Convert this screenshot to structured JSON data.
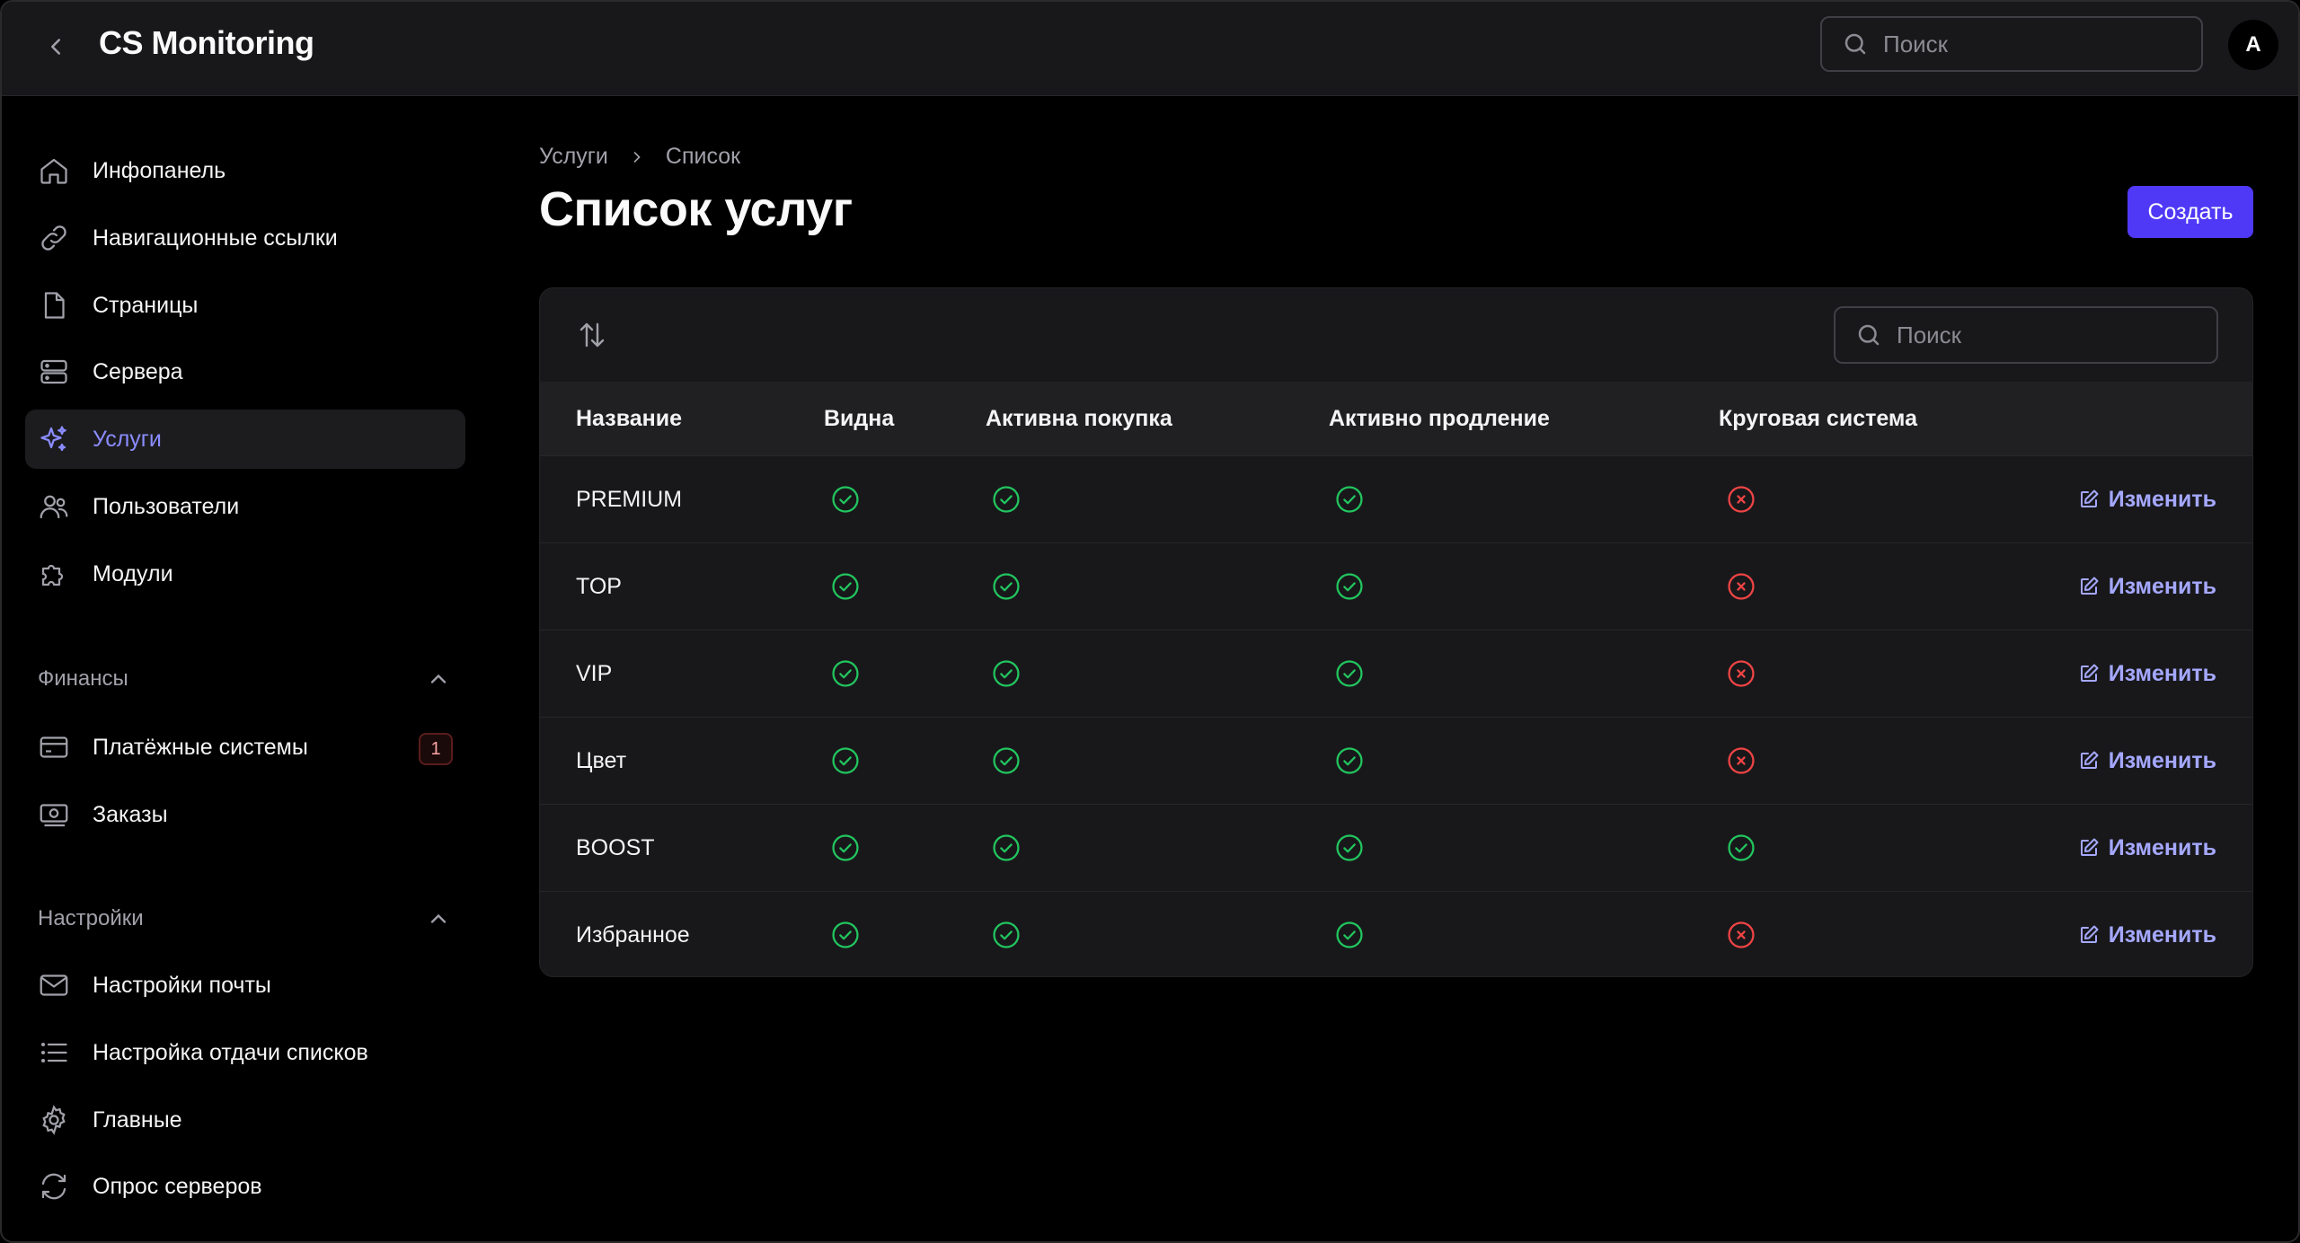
{
  "header": {
    "title": "CS Monitoring",
    "search_placeholder": "Поиск",
    "avatar_initial": "A"
  },
  "sidebar": {
    "items": [
      {
        "label": "Инфопанель",
        "icon": "home-icon"
      },
      {
        "label": "Навигационные ссылки",
        "icon": "link-icon"
      },
      {
        "label": "Страницы",
        "icon": "page-icon"
      },
      {
        "label": "Сервера",
        "icon": "server-icon"
      },
      {
        "label": "Услуги",
        "icon": "sparkles-icon",
        "active": true
      },
      {
        "label": "Пользователи",
        "icon": "users-icon"
      },
      {
        "label": "Модули",
        "icon": "puzzle-icon"
      }
    ],
    "finance": {
      "title": "Финансы",
      "items": [
        {
          "label": "Платёжные системы",
          "icon": "credit-card-icon",
          "badge": "1"
        },
        {
          "label": "Заказы",
          "icon": "banknote-icon"
        }
      ]
    },
    "settings": {
      "title": "Настройки",
      "items": [
        {
          "label": "Настройки почты",
          "icon": "mail-icon"
        },
        {
          "label": "Настройка отдачи списков",
          "icon": "list-icon"
        },
        {
          "label": "Главные",
          "icon": "gear-icon"
        },
        {
          "label": "Опрос серверов",
          "icon": "refresh-icon"
        }
      ]
    }
  },
  "main": {
    "breadcrumb": [
      "Услуги",
      "Список"
    ],
    "title": "Список услуг",
    "create_label": "Создать",
    "table_search_placeholder": "Поиск",
    "columns": [
      "Название",
      "Видна",
      "Активна покупка",
      "Активно продление",
      "Круговая система"
    ],
    "edit_label": "Изменить",
    "rows": [
      {
        "name": "PREMIUM",
        "visible": true,
        "purchase": true,
        "renewal": true,
        "circular": false
      },
      {
        "name": "TOP",
        "visible": true,
        "purchase": true,
        "renewal": true,
        "circular": false
      },
      {
        "name": "VIP",
        "visible": true,
        "purchase": true,
        "renewal": true,
        "circular": false
      },
      {
        "name": "Цвет",
        "visible": true,
        "purchase": true,
        "renewal": true,
        "circular": false
      },
      {
        "name": "BOOST",
        "visible": true,
        "purchase": true,
        "renewal": true,
        "circular": true
      },
      {
        "name": "Избранное",
        "visible": true,
        "purchase": true,
        "renewal": true,
        "circular": false
      }
    ]
  },
  "colors": {
    "accent": "#4f39f6",
    "active_nav": "#8b8cff",
    "check": "#22c55e",
    "cross": "#ef4444",
    "link": "#a5a8ff"
  }
}
